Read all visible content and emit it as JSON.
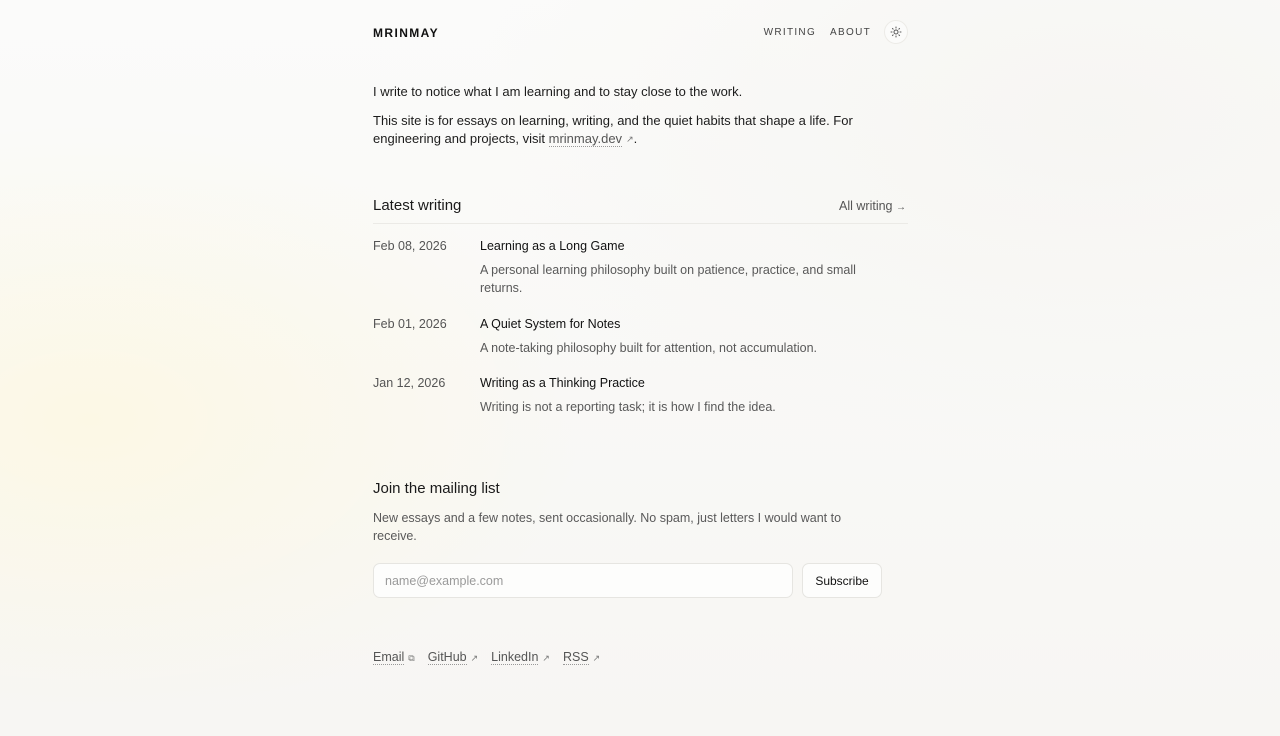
{
  "header": {
    "logo": "MRINMAY",
    "nav": [
      {
        "label": "WRITING"
      },
      {
        "label": "ABOUT"
      }
    ],
    "theme_toggle_icon": "sun-icon"
  },
  "intro": {
    "line1": "I write to notice what I am learning and to stay close to the work.",
    "line2_prefix": "This site is for essays on learning, writing, and the quiet habits that shape a life. For engineering and projects, visit ",
    "line2_link": "mrinmay.dev",
    "line2_suffix": "."
  },
  "latest": {
    "title": "Latest writing",
    "all_link": "All writing",
    "all_link_icon": "arrow-right-icon",
    "posts": [
      {
        "date": "Feb 08, 2026",
        "title": "Learning as a Long Game",
        "desc": "A personal learning philosophy built on patience, practice, and small returns."
      },
      {
        "date": "Feb 01, 2026",
        "title": "A Quiet System for Notes",
        "desc": "A note-taking philosophy built for attention, not accumulation."
      },
      {
        "date": "Jan 12, 2026",
        "title": "Writing as a Thinking Practice",
        "desc": "Writing is not a reporting task; it is how I find the idea."
      }
    ]
  },
  "mailing": {
    "title": "Join the mailing list",
    "desc": "New essays and a few notes, sent occasionally. No spam, just letters I would want to receive.",
    "input_placeholder": "name@example.com",
    "input_value": "",
    "button_label": "Subscribe"
  },
  "footer": {
    "links": [
      {
        "label": "Email",
        "icon": "copy-icon"
      },
      {
        "label": "GitHub",
        "icon": "external-link-icon"
      },
      {
        "label": "LinkedIn",
        "icon": "external-link-icon"
      },
      {
        "label": "RSS",
        "icon": "external-link-icon"
      }
    ]
  },
  "colors": {
    "text": "#1a1a1a",
    "muted": "#595959",
    "border": "#e6e5e1",
    "background": "#f9f8f6"
  }
}
